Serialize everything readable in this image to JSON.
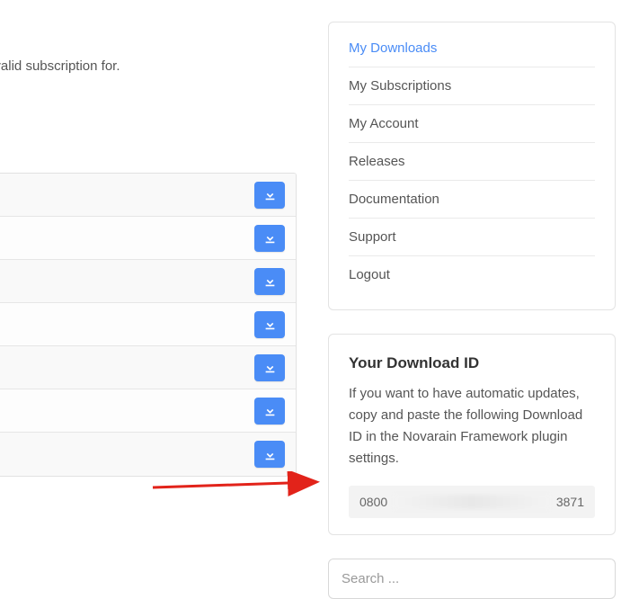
{
  "intro": "ensions you have a valid subscription for.",
  "menu": {
    "items": [
      {
        "label": "My Downloads",
        "active": true
      },
      {
        "label": "My Subscriptions",
        "active": false
      },
      {
        "label": "My Account",
        "active": false
      },
      {
        "label": "Releases",
        "active": false
      },
      {
        "label": "Documentation",
        "active": false
      },
      {
        "label": "Support",
        "active": false
      },
      {
        "label": "Logout",
        "active": false
      }
    ]
  },
  "download_id_card": {
    "title": "Your Download ID",
    "text": "If you want to have automatic updates, copy and paste the following Download ID in the Novarain Framework plugin settings.",
    "id_prefix": "0800",
    "id_suffix": "3871"
  },
  "search": {
    "placeholder": "Search ..."
  },
  "download_rows": 7
}
